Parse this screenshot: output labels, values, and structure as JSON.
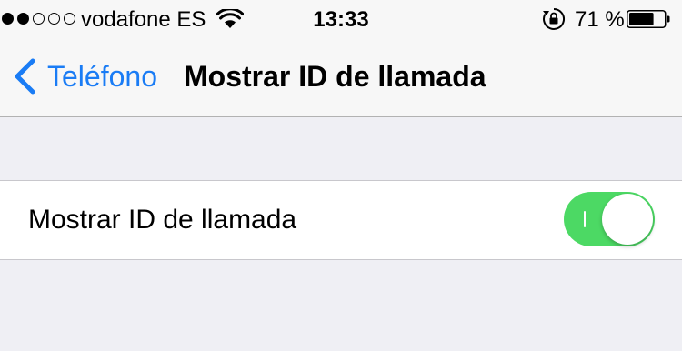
{
  "status_bar": {
    "signal_strength": 2,
    "signal_max": 5,
    "carrier": "vodafone ES",
    "wifi_icon": "wifi-icon",
    "time": "13:33",
    "rotation_lock_icon": "rotation-lock-icon",
    "battery_percent": "71 %",
    "battery_level": 0.71
  },
  "nav": {
    "back_label": "Teléfono",
    "title": "Mostrar ID de llamada"
  },
  "settings": {
    "row_label": "Mostrar ID de llamada",
    "toggle_on": true
  },
  "colors": {
    "accent_blue": "#1a7cf5",
    "toggle_green": "#4cd964",
    "background": "#efeff4",
    "bar_background": "#f7f7f7"
  }
}
